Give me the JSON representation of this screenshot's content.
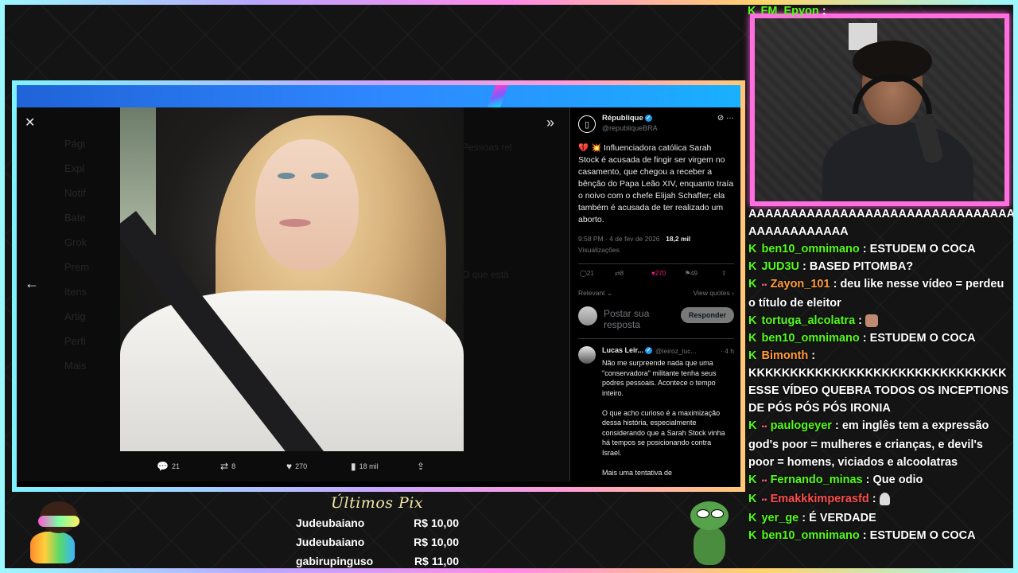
{
  "tweet": {
    "author_name": "République",
    "author_handle": "@republiqueBRA",
    "text": "💔 💥 Influenciadora católica Sarah Stock é acusada de fingir ser virgem no casamento, que chegou a receber a bênção do Papa Leão XIV, enquanto traía o noivo com o chefe Elijah Schaffer; ela também é acusada de ter realizado um aborto.",
    "time": "9:58 PM · 4 de fev de 2026 · ",
    "views_count": "18,2 mil",
    "views_label": "Visualizações",
    "replies": "21",
    "reposts": "8",
    "likes": "270",
    "bookmarks": "49",
    "sort_label": "Relevant",
    "quotes_label": "View quotes",
    "reply_placeholder": "Postar sua resposta",
    "reply_button": "Responder"
  },
  "media_actions": {
    "replies": "21",
    "reposts": "8",
    "likes": "270",
    "views": "18 mil"
  },
  "comment": {
    "name": "Lucas Leir...",
    "handle": "@leiroz_luc...",
    "time": "· 4 h",
    "text": "Não me surpreende nada que uma \"conservadora\" militante tenha seus podres pessoais. Acontece o tempo inteiro.\n\nO que acho curioso é a maximização dessa história, especialmente considerando que a Sarah Stock vinha há tempos se posicionando contra Israel.\n\nMais uma tentativa de"
  },
  "ghost_nav": [
    "Pági",
    "Expl",
    "Notif",
    "Bate",
    "Grok",
    "Prem",
    "Itens",
    "Artig",
    "Perfi",
    "Mais"
  ],
  "ghost_right": [
    "Pessoas rel",
    "O que está",
    "",
    "",
    ""
  ],
  "chat_top": {
    "user": "FM_Epyon",
    "sep": " :"
  },
  "chat": [
    {
      "user": "",
      "color": "#ffffff",
      "text": "AAAAAAAAAAAAAAAAAAAAAAAAAAAAAAAAAA AAAAAAAAAAAA"
    },
    {
      "user": "ben10_omnimano",
      "color": "#53fc18",
      "text": "ESTUDEM O COCA"
    },
    {
      "user": "JUD3U",
      "color": "#53fc18",
      "text": "BASED PITOMBA?"
    },
    {
      "user": "Zayon_101",
      "color": "#ff9a3c",
      "text": "deu like nesse vídeo = perdeu o título de eleitor"
    },
    {
      "user": "tortuga_alcolatra",
      "color": "#53fc18",
      "text": ""
    },
    {
      "user": "ben10_omnimano",
      "color": "#53fc18",
      "text": "ESTUDEM O COCA"
    },
    {
      "user": "Bimonth",
      "color": "#ff9a3c",
      "text": "KKKKKKKKKKKKKKKKKKKKKKKKKKKKKKK ESSE VÍDEO QUEBRA TODOS OS INCEPTIONS DE PÓS PÓS PÓS IRONIA"
    },
    {
      "user": "paulogeyer",
      "color": "#53fc18",
      "text": "em inglês tem a expressão god's poor = mulheres e crianças, e devil's poor = homens, viciados e alcoolatras"
    },
    {
      "user": "Fernando_minas",
      "color": "#53fc18",
      "text": "Que odio"
    },
    {
      "user": "Emakkkimperasfd",
      "color": "#ff4d4d",
      "text": ""
    },
    {
      "user": "yer_ge",
      "color": "#53fc18",
      "text": "É VERDADE"
    },
    {
      "user": "ben10_omnimano",
      "color": "#53fc18",
      "text": "ESTUDEM O COCA"
    }
  ],
  "pix": {
    "title": "Últimos Pix",
    "rows": [
      {
        "name": "Judeubaiano",
        "amount": "R$ 10,00"
      },
      {
        "name": "Judeubaiano",
        "amount": "R$ 10,00"
      },
      {
        "name": "gabirupinguso",
        "amount": "R$ 11,00"
      }
    ]
  },
  "colors": {
    "accent_pink": "#ff6fe0",
    "kick_green": "#53fc18",
    "x_blue": "#1d9bf0",
    "like_pink": "#f91880"
  }
}
